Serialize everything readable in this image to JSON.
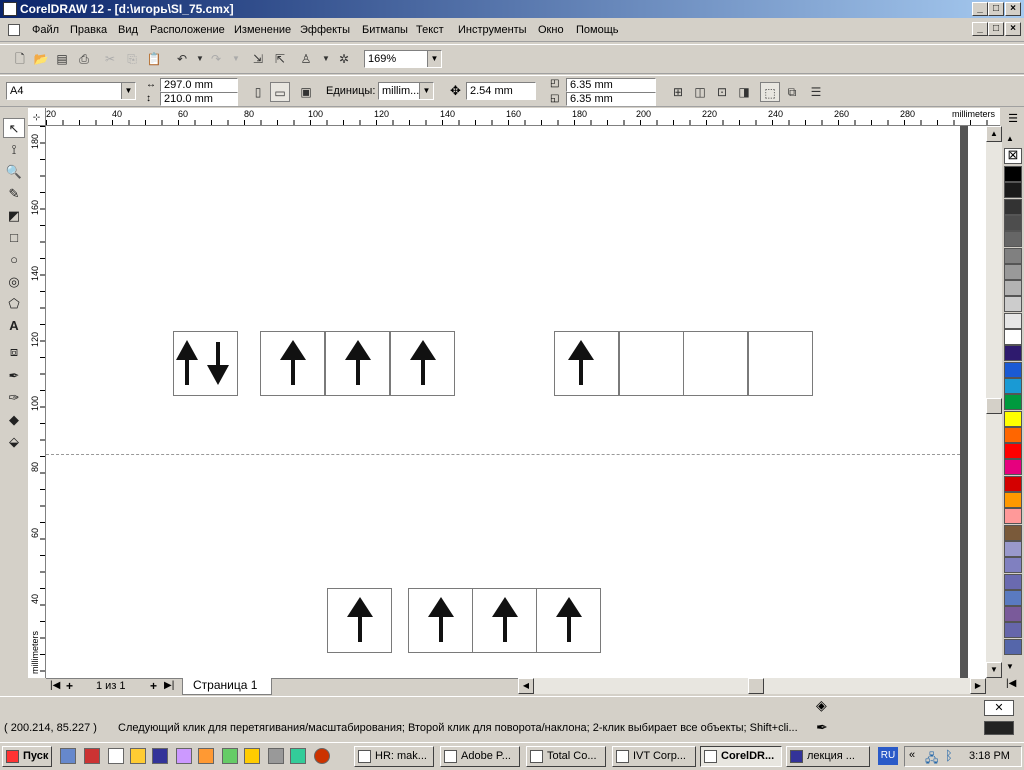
{
  "window": {
    "title": "CorelDRAW 12 - [d:\\игорь\\SI_75.cmx]"
  },
  "menu": [
    "Файл",
    "Правка",
    "Вид",
    "Расположение",
    "Изменение",
    "Эффекты",
    "Битмапы",
    "Текст",
    "Инструменты",
    "Окно",
    "Помощь"
  ],
  "toolbar": {
    "zoom": "169%"
  },
  "propbar": {
    "page_size": "A4",
    "width": "297.0 mm",
    "height": "210.0 mm",
    "units_label": "Единицы:",
    "units_value": "millim...",
    "nudge": "2.54 mm",
    "dup_x": "6.35 mm",
    "dup_y": "6.35 mm"
  },
  "ruler": {
    "units": "millimeters",
    "h_ticks": [
      "20",
      "40",
      "60",
      "80",
      "100",
      "120",
      "140",
      "160",
      "180",
      "200",
      "220",
      "240",
      "260",
      "280"
    ],
    "v_ticks": [
      "180",
      "160",
      "140",
      "120",
      "100",
      "80",
      "60",
      "40"
    ],
    "v_units": "millimeters"
  },
  "pages": {
    "counter": "1 из 1",
    "tab": "Страница 1"
  },
  "status": {
    "coords": "( 200.214, 85.227 )",
    "hint": "Следующий клик для перетягивания/масштабирования; Второй клик для поворота/наклона; 2-клик выбирает все объекты; Shift+cli..."
  },
  "taskbar": {
    "start": "Пуск",
    "tasks": [
      "HR: mak...",
      "Adobe P...",
      "Total Co...",
      "IVT Corp...",
      "CorelDR...",
      "лекция ..."
    ],
    "lang": "RU",
    "clock": "3:18 PM"
  },
  "colors": {
    "palette": [
      "#000000",
      "#1a1a1a",
      "#333333",
      "#4d4d4d",
      "#666666",
      "#808080",
      "#999999",
      "#b3b3b3",
      "#cccccc",
      "#e6e6e6",
      "#ffffff",
      "#2e1a6e",
      "#1a5ad4",
      "#1a9ad4",
      "#009a3e",
      "#ffff00",
      "#ff6600",
      "#ff0000",
      "#e6007e",
      "#d40000",
      "#ff9900",
      "#ff9999",
      "#7a5a3a",
      "#9999cc",
      "#8080c0",
      "#6a6ab0",
      "#5a7ac0",
      "#7a5a9a",
      "#6666aa",
      "#5566aa"
    ]
  }
}
